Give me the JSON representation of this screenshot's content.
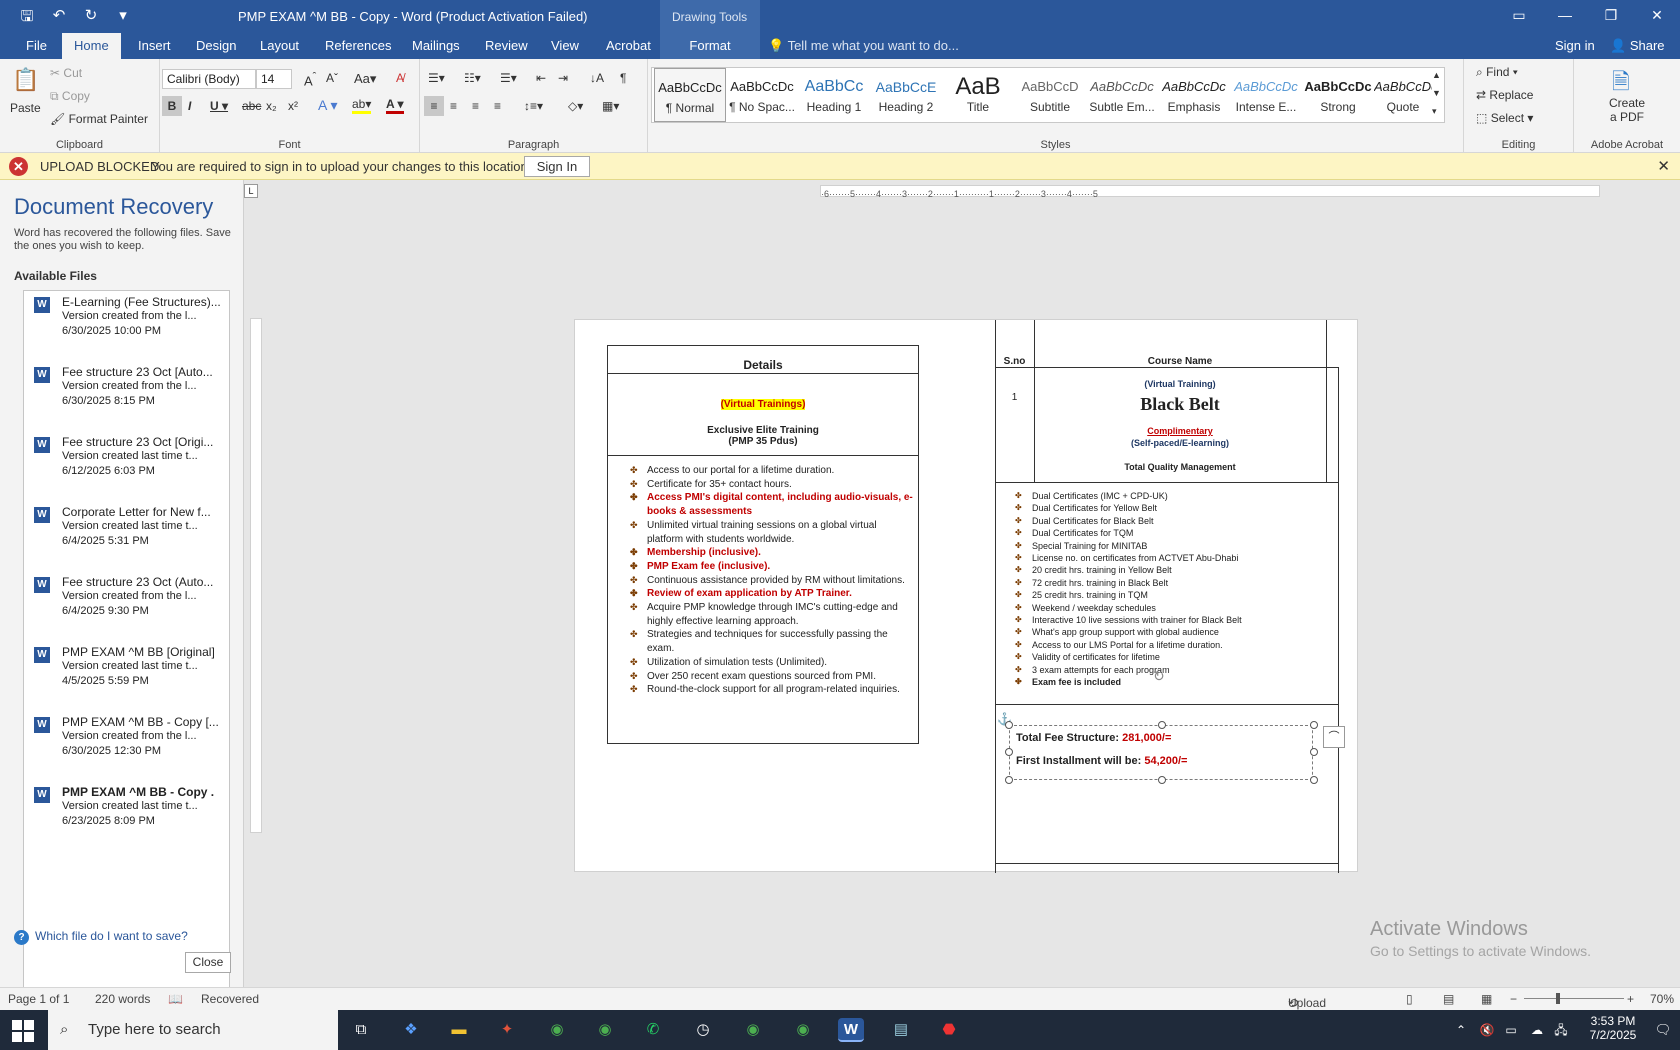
{
  "window": {
    "title": "PMP EXAM ^M BB - Copy - Word (Product Activation Failed)",
    "context_tab_group": "Drawing Tools"
  },
  "tabs": [
    "File",
    "Home",
    "Insert",
    "Design",
    "Layout",
    "References",
    "Mailings",
    "Review",
    "View",
    "Acrobat",
    "Format"
  ],
  "tell_me": "Tell me what you want to do...",
  "sign_in": "Sign in",
  "share": "Share",
  "ribbon": {
    "clipboard": {
      "paste": "Paste",
      "cut": "Cut",
      "copy": "Copy",
      "format_painter": "Format Painter",
      "label": "Clipboard"
    },
    "font": {
      "name": "Calibri (Body)",
      "size": "14",
      "label": "Font"
    },
    "paragraph": {
      "label": "Paragraph"
    },
    "styles": {
      "label": "Styles",
      "items": [
        {
          "sample": "AaBbCcDc",
          "name": "¶ Normal"
        },
        {
          "sample": "AaBbCcDc",
          "name": "¶ No Spac..."
        },
        {
          "sample": "AaBbCc",
          "name": "Heading 1"
        },
        {
          "sample": "AaBbCcE",
          "name": "Heading 2"
        },
        {
          "sample": "AaB",
          "name": "Title"
        },
        {
          "sample": "AaBbCcD",
          "name": "Subtitle"
        },
        {
          "sample": "AaBbCcDc",
          "name": "Subtle Em..."
        },
        {
          "sample": "AaBbCcDc",
          "name": "Emphasis"
        },
        {
          "sample": "AaBbCcDc",
          "name": "Intense E..."
        },
        {
          "sample": "AaBbCcDc",
          "name": "Strong"
        },
        {
          "sample": "AaBbCcDc",
          "name": "Quote"
        }
      ]
    },
    "editing": {
      "find": "Find",
      "replace": "Replace",
      "select": "Select",
      "label": "Editing"
    },
    "acrobat": {
      "create": "Create",
      "pdf": "a PDF",
      "label": "Adobe Acrobat"
    }
  },
  "message_bar": {
    "title": "UPLOAD BLOCKED",
    "text": "You are required to sign in to upload your changes to this location.",
    "button": "Sign In"
  },
  "recovery": {
    "heading": "Document Recovery",
    "desc": "Word has recovered the following files. Save the ones you wish to keep.",
    "available": "Available Files",
    "files": [
      {
        "name": "E-Learning (Fee Structures)...",
        "note": "Version created from the l...",
        "date": "6/30/2025 10:00 PM"
      },
      {
        "name": "Fee structure 23 Oct  [Auto...",
        "note": "Version created from the l...",
        "date": "6/30/2025 8:15 PM"
      },
      {
        "name": "Fee structure 23 Oct  [Origi...",
        "note": "Version created last time t...",
        "date": "6/12/2025 6:03 PM"
      },
      {
        "name": "Corporate Letter for New f...",
        "note": "Version created last time t...",
        "date": "6/4/2025 5:31 PM"
      },
      {
        "name": "Fee structure 23 Oct (Auto...",
        "note": "Version created from the l...",
        "date": "6/4/2025 9:30 PM"
      },
      {
        "name": "PMP EXAM ^M BB  [Original]",
        "note": "Version created last time t...",
        "date": "4/5/2025 5:59 PM"
      },
      {
        "name": "PMP EXAM ^M BB - Copy  [...",
        "note": "Version created from the l...",
        "date": "6/30/2025 12:30 PM"
      },
      {
        "name": "PMP EXAM ^M BB - Copy .",
        "note": "Version created last time t...",
        "date": "6/23/2025 8:09 PM"
      }
    ],
    "help": "Which file do I want to save?",
    "close": "Close"
  },
  "document": {
    "left": {
      "header": "Details",
      "virtual": "(Virtual Trainings)",
      "exclusive": "Exclusive Elite Training",
      "pdus": "(PMP 35 Pdus)",
      "bullets": [
        {
          "t": "Access to our portal for a lifetime duration.",
          "red": false
        },
        {
          "t": "Certificate for 35+ contact hours.",
          "red": false
        },
        {
          "t": "Access PMI's digital content, including audio-visuals, e-books & assessments",
          "red": true
        },
        {
          "t": "Unlimited virtual training sessions on a global virtual platform with students worldwide.",
          "red": false
        },
        {
          "t": "Membership (inclusive).",
          "red": true
        },
        {
          "t": "PMP Exam fee (inclusive).",
          "red": true
        },
        {
          "t": "Continuous assistance provided by RM without limitations.",
          "red": false
        },
        {
          "t": " Review of exam application by ATP Trainer.",
          "red": true
        },
        {
          "t": "Acquire PMP knowledge through IMC's cutting-edge and highly effective learning approach.",
          "red": false
        },
        {
          "t": "Strategies and techniques for successfully passing the exam.",
          "red": false
        },
        {
          "t": "Utilization of simulation tests (Unlimited).",
          "red": false
        },
        {
          "t": "Over 250 recent exam questions sourced from PMI.",
          "red": false
        },
        {
          "t": "Round-the-clock support for all program-related inquiries.",
          "red": false
        }
      ]
    },
    "right": {
      "sno": "S.no",
      "course": "Course Name",
      "num": "1",
      "virtual": "(Virtual Training)",
      "belt": "Black Belt",
      "complimentary": "Complimentary",
      "self": "(Self-paced/E-learning)",
      "tqm": "Total Quality Management",
      "bullets": [
        "Dual Certificates (IMC + CPD-UK)",
        "Dual Certificates for Yellow Belt",
        "Dual Certificates for Black Belt",
        "Dual Certificates for  TQM",
        "Special Training for MINITAB",
        "License no. on certificates from ACTVET Abu-Dhabi",
        "20 credit hrs. training in Yellow Belt",
        "72 credit hrs. training in Black Belt",
        "25 credit hrs. training in  TQM",
        "Weekend / weekday schedules",
        "Interactive 10 live sessions with trainer for Black Belt",
        "What's app group support with global audience",
        "Access to our LMS Portal for a lifetime duration.",
        "Validity of certificates for lifetime",
        "3 exam attempts for each program",
        "Exam fee is included"
      ],
      "fee_label": "Total Fee Structure: ",
      "fee_value": "281,000/=",
      "inst_label": "First Installment will be: ",
      "inst_value": "54,200/="
    }
  },
  "status": {
    "page": "Page 1 of 1",
    "words": "220 words",
    "recovered": "Recovered",
    "upload": "Upload Failed",
    "zoom": "70%"
  },
  "taskbar": {
    "search": "Type here to search",
    "time": "3:53 PM",
    "date": "7/2/2025"
  },
  "watermark": {
    "line1": "Activate Windows",
    "line2": "Go to Settings to activate Windows."
  },
  "ruler": {
    "h": "·6·······5·······4·······3·······2·······1··········1·······2·······3·······4·······5"
  },
  "colors": {
    "accent": "#2b579a",
    "error": "#cc3333",
    "red_text": "#c00000"
  }
}
